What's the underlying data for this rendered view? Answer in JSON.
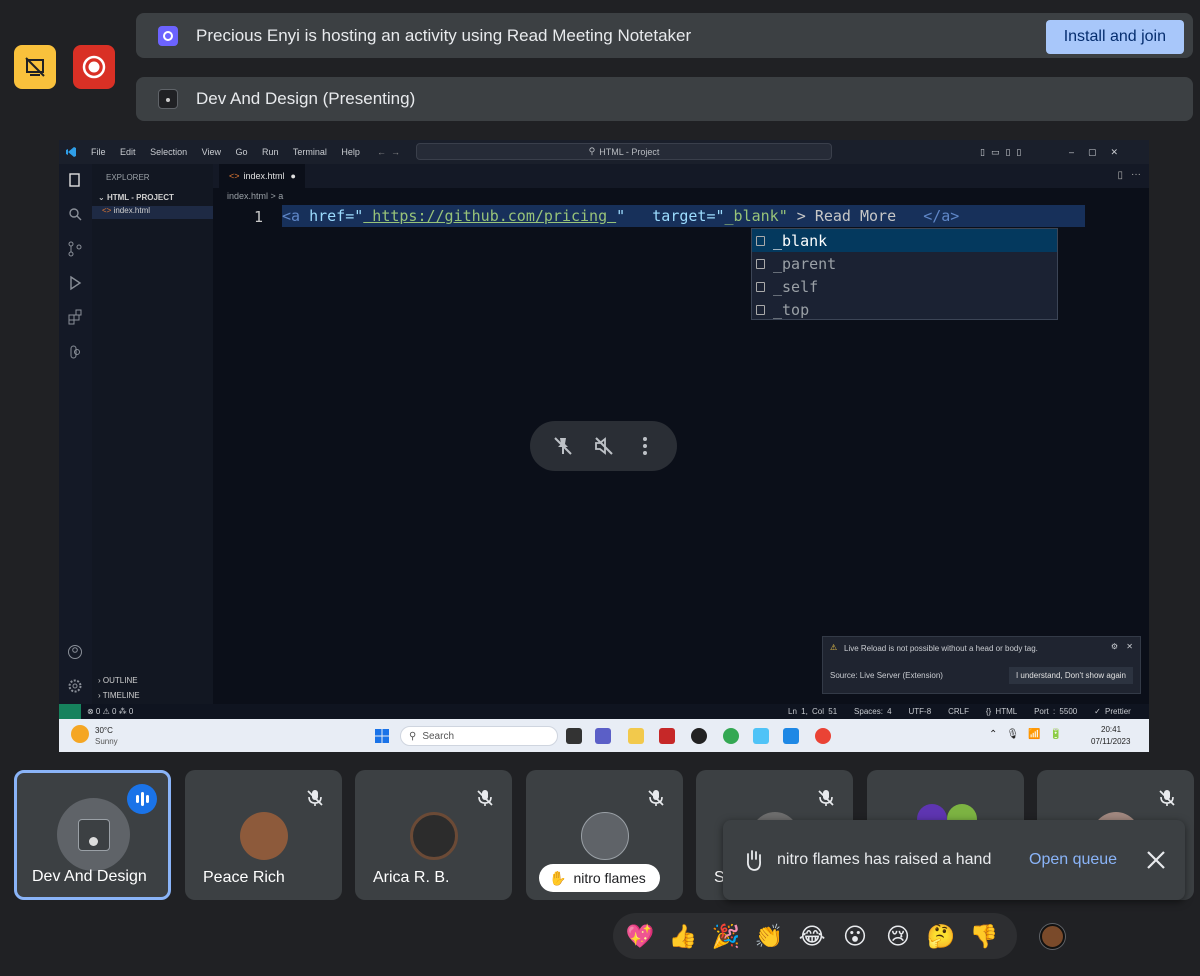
{
  "activity_banner": {
    "text": "Precious Enyi is hosting an activity using Read Meeting Notetaker",
    "button": "Install and join"
  },
  "presenting_banner": {
    "text": "Dev And Design (Presenting)"
  },
  "vscode": {
    "menu": [
      "File",
      "Edit",
      "Selection",
      "View",
      "Go",
      "Run",
      "Terminal",
      "Help"
    ],
    "search": "HTML - Project",
    "explorer_title": "EXPLORER",
    "project": "HTML - PROJECT",
    "file": "index.html",
    "tab": "index.html",
    "breadcrumb": "index.html > a",
    "line_number": "1",
    "code": {
      "open": "<a",
      "href_attr": " href=\"",
      "href_value": " https://github.com/pricing ",
      "q1": "\"   ",
      "target_attr": "target=\"",
      "target_value": "_blank\"",
      "rest": " > Read More   ",
      "close": "</a>"
    },
    "suggestions": [
      "_blank",
      "_parent",
      "_self",
      "_top"
    ],
    "outline": "OUTLINE",
    "timeline": "TIMELINE",
    "notice_text": "Live Reload is not possible without a head or body tag.",
    "notice_source": "Source: Live Server (Extension)",
    "notice_button": "I understand, Don't show again",
    "status_left": "⊗ 0 ⚠ 0   ⁂ 0",
    "status_right": [
      "Ln 1, Col 51",
      "Spaces: 4",
      "UTF-8",
      "CRLF",
      "{} HTML",
      "Port : 5500",
      "✓ Prettier"
    ]
  },
  "taskbar": {
    "weather_temp": "30°C",
    "weather_desc": "Sunny",
    "search": "Search",
    "time": "20:41",
    "date": "07/11/2023"
  },
  "participants": [
    {
      "name": "Dev And Design"
    },
    {
      "name": "Peace Rich"
    },
    {
      "name": "Arica R. B."
    },
    {
      "name": "nitro flames"
    },
    {
      "name": "S"
    }
  ],
  "toast": {
    "message": "nitro flames has raised a hand",
    "action": "Open queue"
  },
  "reactions": [
    "💖",
    "👍",
    "🎉",
    "👏",
    "😂",
    "😮",
    "😢",
    "🤔",
    "👎"
  ],
  "colors": {
    "accent": "#8ab4f8",
    "install_bg": "#a8c7fa",
    "record": "#d93025",
    "present_badge": "#f9c13c"
  }
}
